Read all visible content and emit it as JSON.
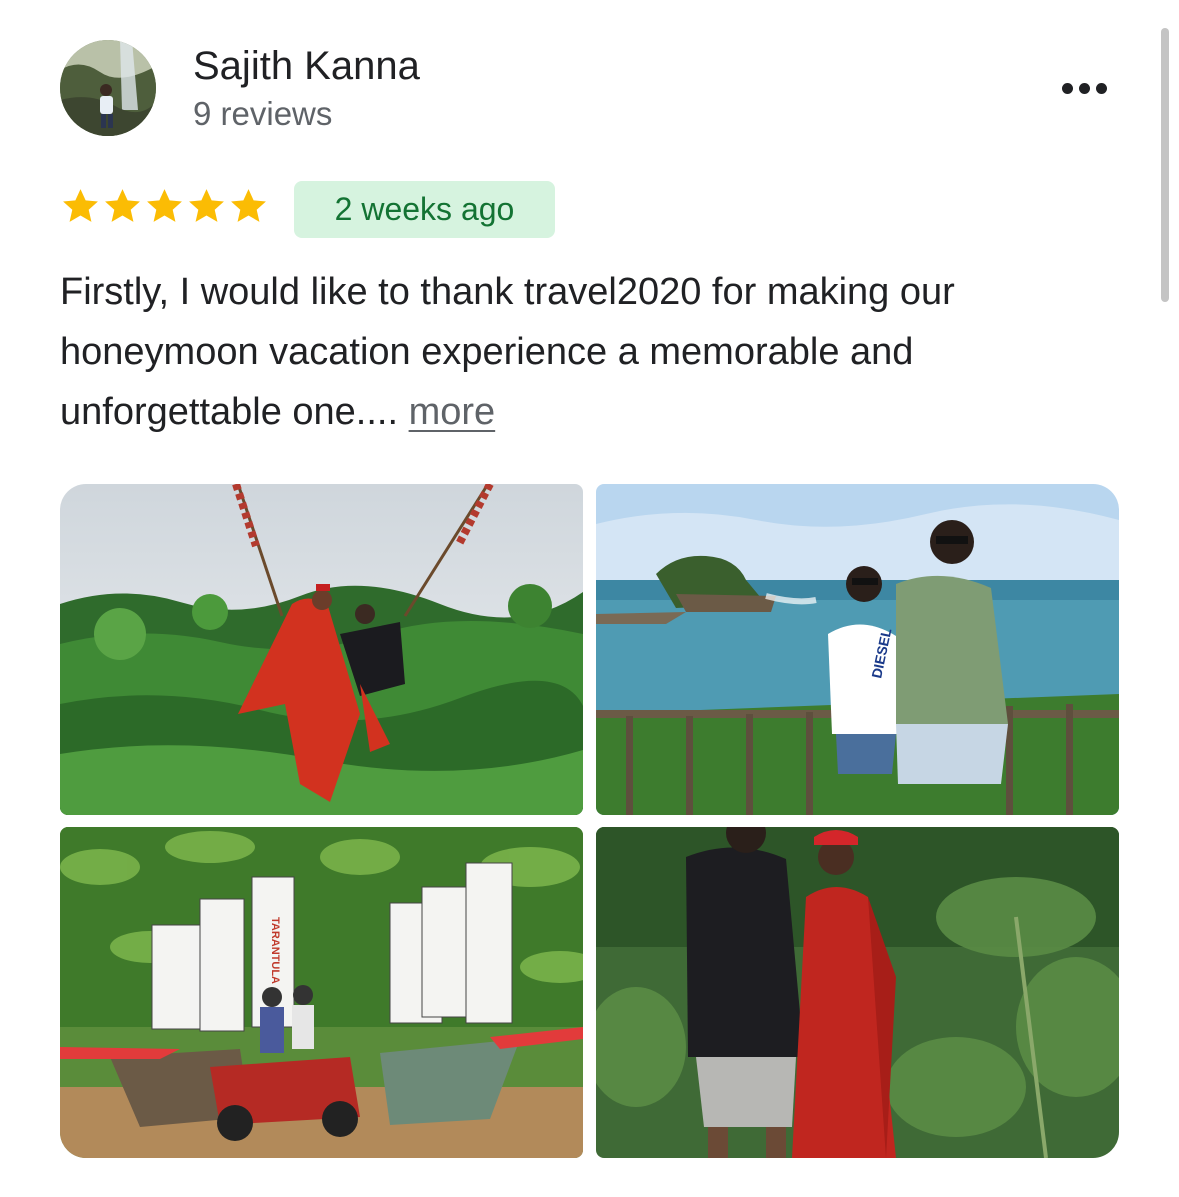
{
  "reviewer": {
    "name": "Sajith Kanna",
    "review_count": "9 reviews"
  },
  "review": {
    "rating": 5,
    "rating_max": 5,
    "time": "2 weeks ago",
    "text": "Firstly, I would like to thank travel2020 for making our honeymoon vacation experience a memorable and unforgettable one....",
    "more_label": "more"
  },
  "photos": {
    "swing_sign_text": "",
    "atv_sign_text": "TARANTULA",
    "tshirt_text": "DIESEL"
  },
  "colors": {
    "star": "#fbbc04",
    "badge_bg": "#d6f3df",
    "badge_text": "#137333",
    "more_link": "#5f6368",
    "secondary_text": "#5f6368"
  },
  "icons": {
    "menu": "more-horizontal-icon",
    "star": "star-icon"
  }
}
